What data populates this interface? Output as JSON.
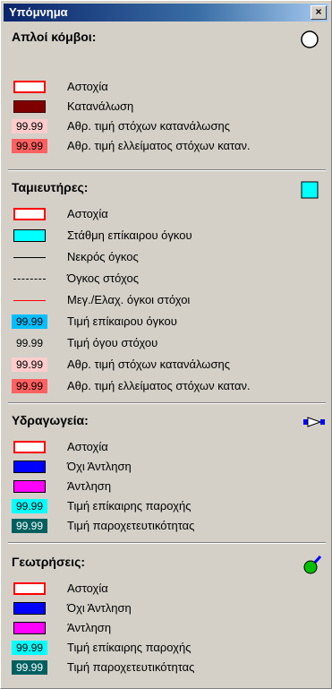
{
  "window": {
    "title": "Υπόμνημα",
    "close_label": "×"
  },
  "colors": {
    "red": "#ff0000",
    "dark_red": "#7f0000",
    "cyan": "#00ffff",
    "blue": "#0000ff",
    "magenta": "#ff00ff",
    "teal": "#006060"
  },
  "sections": {
    "nodes": {
      "title": "Απλοί κόμβοι:",
      "icon": "circle-icon",
      "items": [
        {
          "kind": "outline-red",
          "label": "Αστοχία"
        },
        {
          "kind": "darkred",
          "label": "Κατανάλωση"
        },
        {
          "kind": "num-pink",
          "value": "99.99",
          "label": "Αθρ. τιμή στόχων κατανάλωσης"
        },
        {
          "kind": "num-red",
          "value": "99.99",
          "label": "Αθρ. τιμή ελλείματος στόχων καταν."
        }
      ]
    },
    "reservoirs": {
      "title": "Ταμιευτήρες:",
      "icon": "square-cyan-icon",
      "items": [
        {
          "kind": "outline-red",
          "label": "Αστοχία"
        },
        {
          "kind": "cyan",
          "label": "Στάθμη επίκαιρου όγκου"
        },
        {
          "kind": "line-solid",
          "label": "Νεκρός όγκος"
        },
        {
          "kind": "line-dash",
          "label": "Όγκος στόχος"
        },
        {
          "kind": "line-red",
          "label": "Μεγ./Ελαχ. όγκοι στόχοι"
        },
        {
          "kind": "num-blue",
          "value": "99.99",
          "label": "Τιμή επίκαιρου όγκου"
        },
        {
          "kind": "num-plain",
          "value": "99.99",
          "label": "Τιμή όγου στόχου"
        },
        {
          "kind": "num-pink",
          "value": "99.99",
          "label": "Αθρ. τιμή στόχων κατανάλωσης"
        },
        {
          "kind": "num-red",
          "value": "99.99",
          "label": "Αθρ. τιμή ελλείματος στόχων καταν."
        }
      ]
    },
    "aqueducts": {
      "title": "Υδραγωγεία:",
      "icon": "aqueduct-icon",
      "items": [
        {
          "kind": "outline-red",
          "label": "Αστοχία"
        },
        {
          "kind": "blue",
          "label": "Όχι Άντληση"
        },
        {
          "kind": "magenta",
          "label": "Άντληση"
        },
        {
          "kind": "num-cyan",
          "value": "99.99",
          "label": "Τιμή επίκαιρης παροχής"
        },
        {
          "kind": "num-teal",
          "value": "99.99",
          "label": "Τιμή παροχετευτικότητας"
        }
      ]
    },
    "boreholes": {
      "title": "Γεωτρήσεις:",
      "icon": "borehole-icon",
      "items": [
        {
          "kind": "outline-red",
          "label": "Αστοχία"
        },
        {
          "kind": "blue",
          "label": "Όχι Άντληση"
        },
        {
          "kind": "magenta",
          "label": "Άντληση"
        },
        {
          "kind": "num-cyan",
          "value": "99.99",
          "label": "Τιμή επίκαιρης παροχής"
        },
        {
          "kind": "num-teal",
          "value": "99.99",
          "label": "Τιμή παροχετευτικότητας"
        }
      ]
    }
  }
}
